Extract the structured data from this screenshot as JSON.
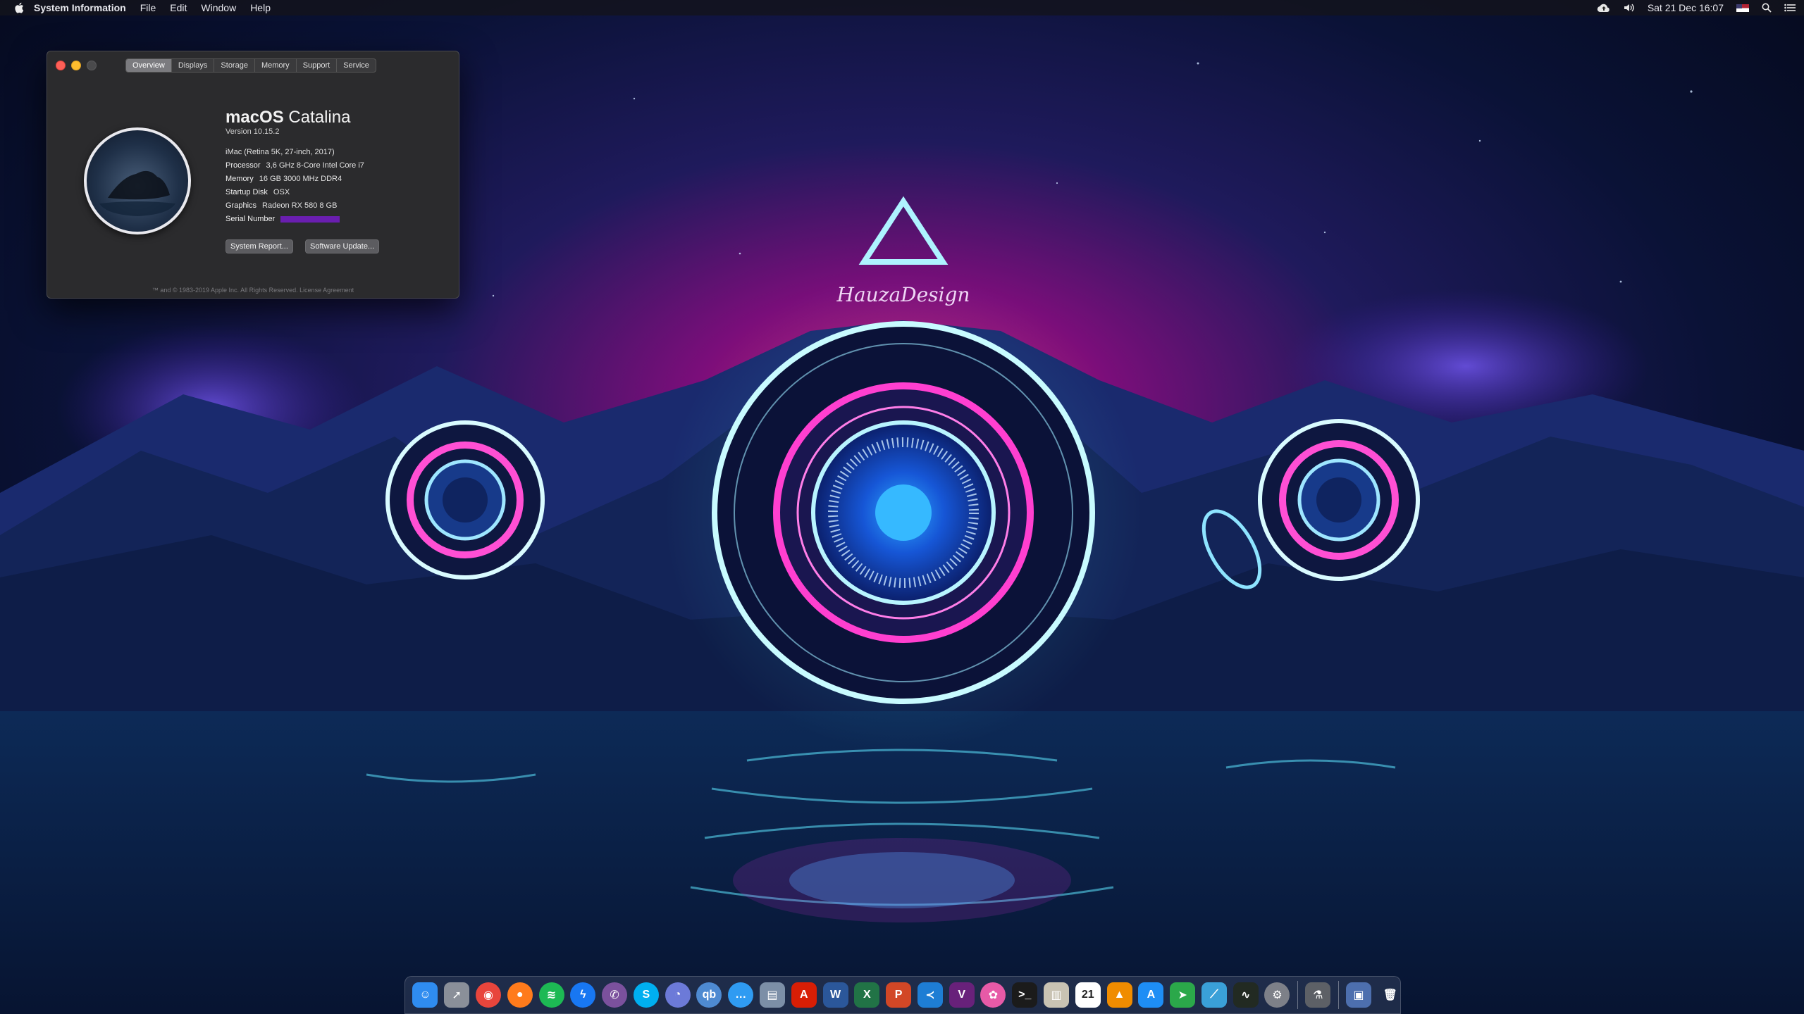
{
  "menubar": {
    "app_name": "System Information",
    "menus": [
      "File",
      "Edit",
      "Window",
      "Help"
    ],
    "datetime": "Sat 21 Dec  16:07"
  },
  "about": {
    "tabs": [
      "Overview",
      "Displays",
      "Storage",
      "Memory",
      "Support",
      "Service"
    ],
    "active_tab": "Overview",
    "os_name_bold": "macOS",
    "os_name_rest": " Catalina",
    "version": "Version 10.15.2",
    "model": "iMac (Retina 5K, 27-inch, 2017)",
    "specs": [
      {
        "key": "Processor",
        "value": "3,6 GHz 8-Core Intel Core i7"
      },
      {
        "key": "Memory",
        "value": "16 GB 3000 MHz DDR4"
      },
      {
        "key": "Startup Disk",
        "value": "OSX"
      },
      {
        "key": "Graphics",
        "value": "Radeon RX 580 8 GB"
      }
    ],
    "serial_label": "Serial Number",
    "buttons": {
      "system_report": "System Report...",
      "software_update": "Software Update..."
    },
    "footer": "™ and © 1983-2019 Apple Inc. All Rights Reserved. License Agreement"
  },
  "wallpaper": {
    "signature": "HauzaDesign"
  },
  "dock": {
    "apps": [
      {
        "icon": "finder-icon",
        "color": "#2f8cf0",
        "glyph": "☺"
      },
      {
        "icon": "launchpad-icon",
        "color": "#8a8f99",
        "glyph": "➚"
      },
      {
        "icon": "chrome-icon",
        "color": "#e8453c",
        "glyph": "◉"
      },
      {
        "icon": "firefox-icon",
        "color": "#ff7b1c",
        "glyph": "●"
      },
      {
        "icon": "spotify-icon",
        "color": "#1db954",
        "glyph": "≋"
      },
      {
        "icon": "messenger-icon",
        "color": "#1877f2",
        "glyph": "ϟ"
      },
      {
        "icon": "viber-icon",
        "color": "#7b519d",
        "glyph": "✆"
      },
      {
        "icon": "skype-icon",
        "color": "#00aff0",
        "glyph": "S"
      },
      {
        "icon": "discord-icon",
        "color": "#6c7ad8",
        "glyph": "◔"
      },
      {
        "icon": "qbittorrent-icon",
        "color": "#4e8ad1",
        "glyph": "qb"
      },
      {
        "icon": "messages-icon",
        "color": "#2f9bf2",
        "glyph": "…"
      },
      {
        "icon": "preview-icon",
        "color": "#7c8fa7",
        "glyph": "▤"
      },
      {
        "icon": "acrobat-icon",
        "color": "#d81e05",
        "glyph": "A"
      },
      {
        "icon": "word-icon",
        "color": "#2b579a",
        "glyph": "W"
      },
      {
        "icon": "excel-icon",
        "color": "#217346",
        "glyph": "X"
      },
      {
        "icon": "powerpoint-icon",
        "color": "#d24726",
        "glyph": "P"
      },
      {
        "icon": "vscode-icon",
        "color": "#1e7dd4",
        "glyph": "≺"
      },
      {
        "icon": "visual-studio-icon",
        "color": "#68217a",
        "glyph": "V"
      },
      {
        "icon": "photos-icon",
        "color": "#e75aa7",
        "glyph": "✿"
      },
      {
        "icon": "terminal-icon",
        "color": "#1b1b1b",
        "glyph": ">_"
      },
      {
        "icon": "notes-icon",
        "color": "#c9c3b3",
        "glyph": "▥"
      },
      {
        "icon": "calendar-icon",
        "color": "#ffffff",
        "glyph": "21"
      },
      {
        "icon": "vlc-icon",
        "color": "#f08c00",
        "glyph": "▲"
      },
      {
        "icon": "app-store-icon",
        "color": "#1e8ef5",
        "glyph": "A"
      },
      {
        "icon": "maps-icon",
        "color": "#2ba84a",
        "glyph": "➤"
      },
      {
        "icon": "stocks-icon",
        "color": "#3aa0d8",
        "glyph": "⟋"
      },
      {
        "icon": "activity-monitor-icon",
        "color": "#222a22",
        "glyph": "∿"
      },
      {
        "icon": "system-preferences-icon",
        "color": "#7d8088",
        "glyph": "⚙"
      },
      {
        "icon": "script-editor-icon",
        "color": "#5d6066",
        "glyph": "⚗"
      },
      {
        "icon": "downloads-folder-icon",
        "color": "#4d6fae",
        "glyph": "▣"
      },
      {
        "icon": "trash-icon",
        "color": "#8d96a3",
        "glyph": "🗑"
      }
    ]
  }
}
